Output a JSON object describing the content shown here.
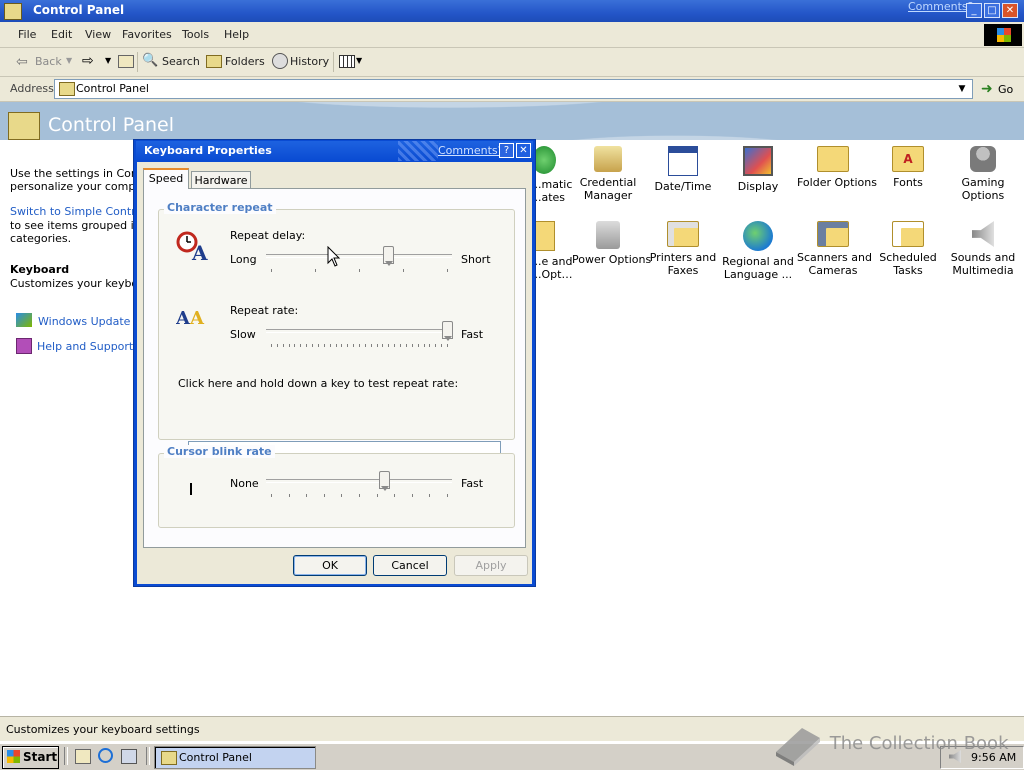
{
  "window": {
    "title": "Control Panel",
    "comments_link": "Comments?",
    "menu": [
      "File",
      "Edit",
      "View",
      "Favorites",
      "Tools",
      "Help"
    ],
    "toolbar": {
      "back": "Back",
      "search": "Search",
      "folders": "Folders",
      "history": "History"
    },
    "address_label": "Address",
    "address_value": "Control Panel",
    "go_label": "Go"
  },
  "control_panel": {
    "header_title": "Control Panel",
    "intro_lines": [
      "Use the settings in Contro",
      "personalize your compute"
    ],
    "switch_link": "Switch to Simple Control P",
    "switch_desc": [
      "to see items grouped into",
      "categories."
    ],
    "selected_title": "Keyboard",
    "selected_desc": "Customizes your keyboar",
    "see_also": [
      "Windows Update",
      "Help and Support"
    ],
    "icons_row1": [
      {
        "label": "...matic\n...ates",
        "icon": "clipped-icon"
      },
      {
        "label": "Credential\nManager",
        "icon": "credential-icon"
      },
      {
        "label": "Date/Time",
        "icon": "calendar-clock-icon"
      },
      {
        "label": "Display",
        "icon": "monitor-icon"
      },
      {
        "label": "Folder Options",
        "icon": "folder-options-icon"
      },
      {
        "label": "Fonts",
        "icon": "fonts-folder-icon"
      },
      {
        "label": "Gaming\nOptions",
        "icon": "joystick-icon"
      }
    ],
    "icons_row2": [
      {
        "label": "...e and\n...Opt…",
        "icon": "clipped-icon"
      },
      {
        "label": "Power Options",
        "icon": "power-plug-icon"
      },
      {
        "label": "Printers and\nFaxes",
        "icon": "printer-icon"
      },
      {
        "label": "Regional and\nLanguage ...",
        "icon": "globe-icon"
      },
      {
        "label": "Scanners and\nCameras",
        "icon": "scanner-icon"
      },
      {
        "label": "Scheduled\nTasks",
        "icon": "scheduled-tasks-icon"
      },
      {
        "label": "Sounds and\nMultimedia",
        "icon": "speaker-icon"
      }
    ]
  },
  "dialog": {
    "title": "Keyboard Properties",
    "comments_link": "Comments?",
    "tabs": [
      "Speed",
      "Hardware"
    ],
    "character_repeat": {
      "group_title": "Character repeat",
      "repeat_delay_label": "Repeat delay:",
      "delay_left": "Long",
      "delay_right": "Short",
      "delay_value": 0.667,
      "repeat_rate_label": "Repeat rate:",
      "rate_left": "Slow",
      "rate_right": "Fast",
      "rate_value": 1.0,
      "test_label": "Click here and hold down a key to test repeat rate:",
      "test_value": ""
    },
    "cursor_blink": {
      "group_title": "Cursor blink rate",
      "left": "None",
      "right": "Fast",
      "value": 0.64
    },
    "buttons": {
      "ok": "OK",
      "cancel": "Cancel",
      "apply": "Apply"
    }
  },
  "statusbar": {
    "text": "Customizes your keyboard settings"
  },
  "taskbar": {
    "start": "Start",
    "task": "Control Panel",
    "clock": "9:56 AM"
  },
  "watermark": "The Collection Book"
}
